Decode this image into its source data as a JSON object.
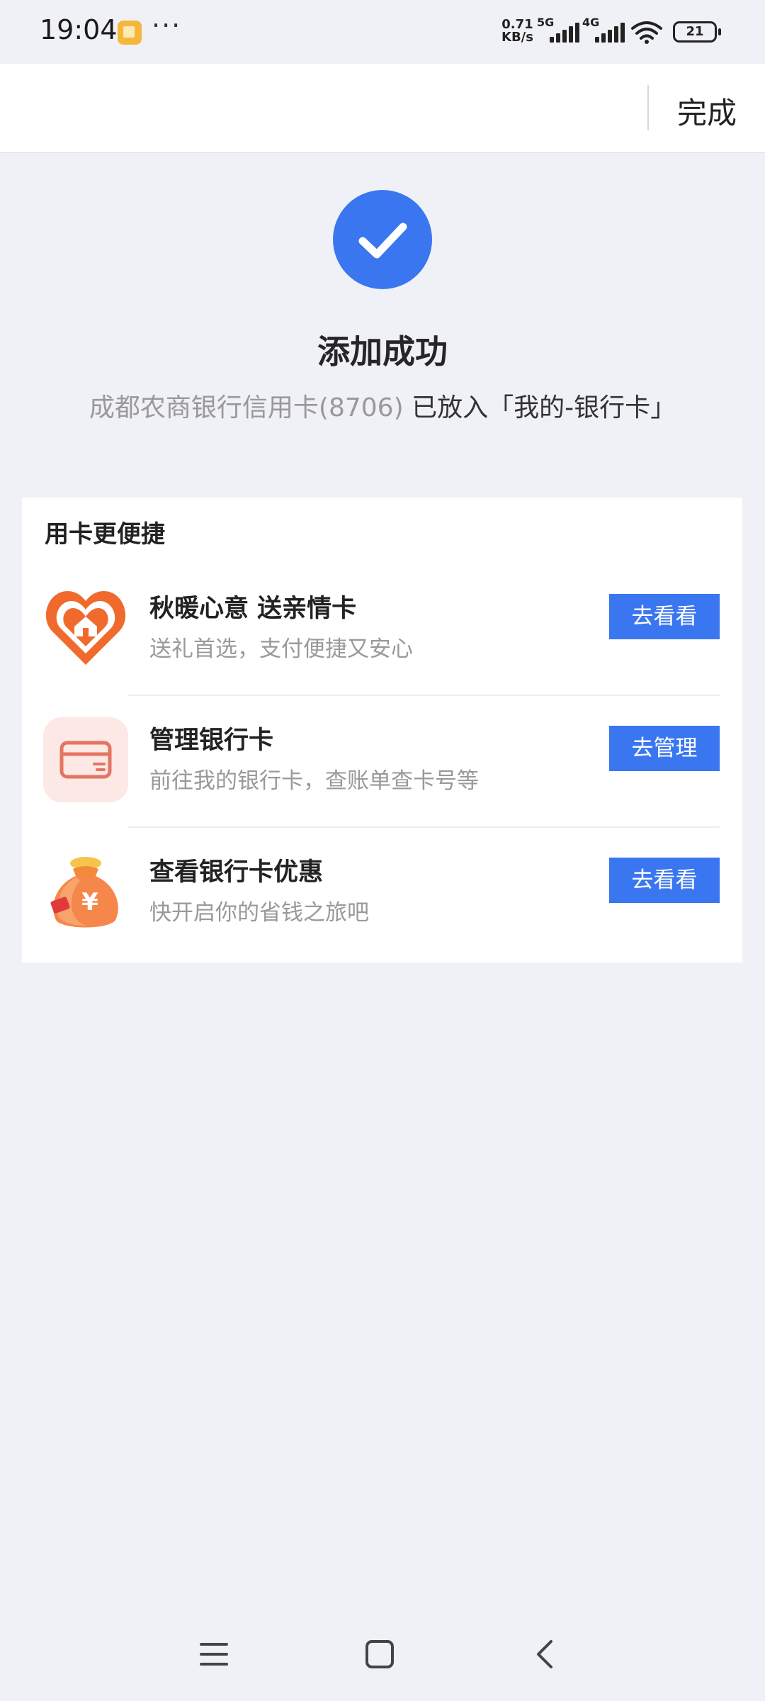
{
  "status_bar": {
    "time": "19:04",
    "more": "···",
    "net_speed_value": "0.71",
    "net_speed_unit": "KB/s",
    "net_5g": "5G",
    "net_4g": "4G",
    "battery": "21",
    "icons": [
      "app-notification-icon",
      "signal-5g-icon",
      "signal-4g-icon",
      "wifi-icon",
      "battery-icon"
    ]
  },
  "header": {
    "done_label": "完成"
  },
  "success": {
    "icon": "check-icon",
    "accent_color": "#3a76ef",
    "title": "添加成功",
    "desc_card": "成都农商银行信用卡(8706)",
    "desc_action": " 已放入「我的-银行卡」"
  },
  "section": {
    "title": "用卡更便捷",
    "items": [
      {
        "icon": "heart-home-icon",
        "title": "秋暖心意 送亲情卡",
        "subtitle": "送礼首选，支付便捷又安心",
        "button": "去看看"
      },
      {
        "icon": "bank-card-icon",
        "title": "管理银行卡",
        "subtitle": "前往我的银行卡，查账单查卡号等",
        "button": "去管理"
      },
      {
        "icon": "money-bag-icon",
        "title": "查看银行卡优惠",
        "subtitle": "快开启你的省钱之旅吧",
        "button": "去看看"
      }
    ]
  },
  "nav_bar": {
    "icons": [
      "menu-icon",
      "home-square-icon",
      "back-chevron-icon"
    ]
  }
}
